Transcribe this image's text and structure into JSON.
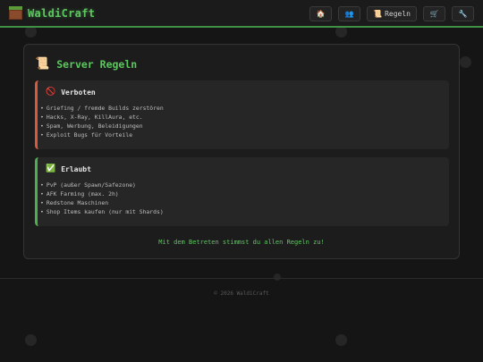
{
  "brand": {
    "name": "WaldiCraft",
    "logo_icon": "grass-block-icon"
  },
  "nav": {
    "items": [
      {
        "icon": "🏠",
        "label": ""
      },
      {
        "icon": "👥",
        "label": ""
      },
      {
        "icon": "📜",
        "label": "Regeln"
      },
      {
        "icon": "🛒",
        "label": ""
      },
      {
        "icon": "🔧",
        "label": ""
      }
    ]
  },
  "rules": {
    "title_icon": "📜",
    "title": "Server Regeln",
    "forbidden": {
      "icon": "🚫",
      "heading": "Verboten",
      "items": [
        "Griefing / fremde Builds zerstören",
        "Hacks, X-Ray, KillAura, etc.",
        "Spam, Werbung, Beleidigungen",
        "Exploit Bugs für Vorteile"
      ]
    },
    "allowed": {
      "icon": "✅",
      "heading": "Erlaubt",
      "items": [
        "PvP (außer Spawn/Safezone)",
        "AFK Farming (max. 2h)",
        "Redstone Maschinen",
        "Shop Items kaufen (nur mit Shards)"
      ]
    },
    "agreement": "Mit dem Betreten stimmst du allen Regeln zu!"
  },
  "footer": {
    "copyright": "© 2026 WaldiCraft"
  },
  "colors": {
    "accent": "#5cc75f",
    "forbidden": "#d9593c",
    "allowed": "#4caf50",
    "background": "#151515"
  }
}
